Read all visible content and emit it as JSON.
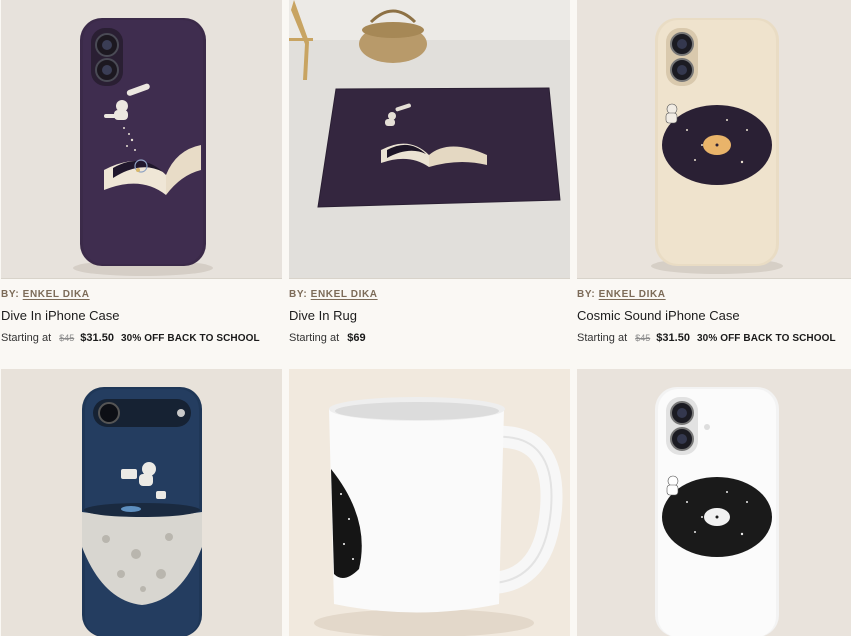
{
  "products": [
    {
      "by_label": "BY:",
      "artist": "ENKEL DIKA",
      "title": "Dive In iPhone Case",
      "starting": "Starting at",
      "old_price": "$45",
      "price": "$31.50",
      "promo": "30% OFF BACK TO SCHOOL"
    },
    {
      "by_label": "BY:",
      "artist": "ENKEL DIKA",
      "title": "Dive In Rug",
      "starting": "Starting at",
      "old_price": "",
      "price": "$69",
      "promo": ""
    },
    {
      "by_label": "BY:",
      "artist": "ENKEL DIKA",
      "title": "Cosmic Sound iPhone Case",
      "starting": "Starting at",
      "old_price": "$45",
      "price": "$31.50",
      "promo": "30% OFF BACK TO SCHOOL"
    }
  ],
  "colors": {
    "page_bg": "#faf8f4",
    "photo_bg_warm": "#e9e3dc",
    "case_purple": "#3a2a48",
    "case_cream": "#efe4cf",
    "case_navy": "#1f3757",
    "artist_brown": "#7c6b58"
  }
}
